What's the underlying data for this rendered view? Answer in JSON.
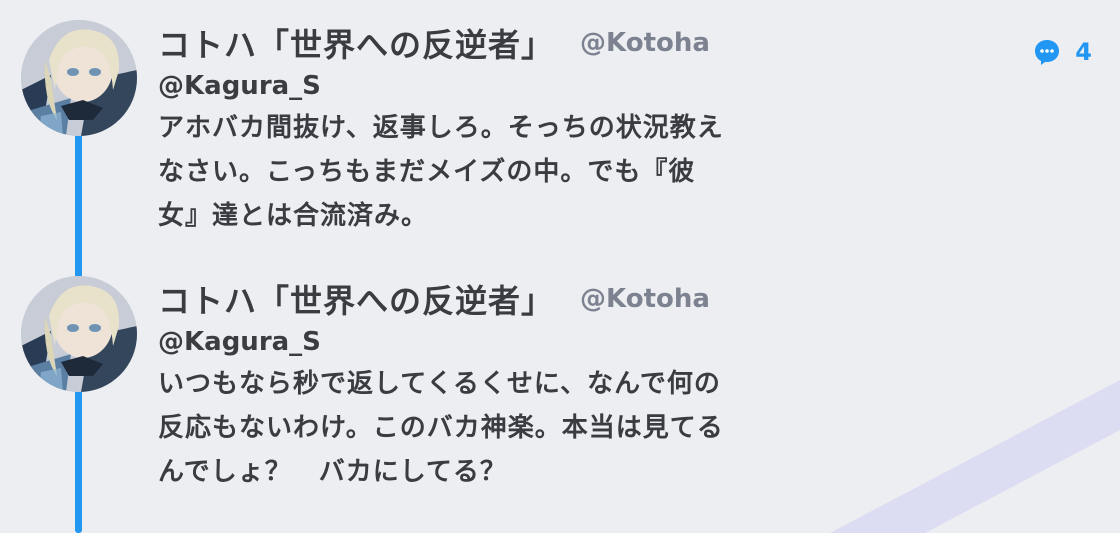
{
  "colors": {
    "accent": "#2196f3",
    "background": "#eceef2",
    "text": "#3b3b42",
    "handle": "#7c8290"
  },
  "posts": [
    {
      "avatar_icon": "character-avatar",
      "display_name": "コトハ「世界への反逆者」",
      "handle": "@Kotoha",
      "reply_to": "@Kagura_S",
      "message": "アホバカ間抜け、返事しろ。そっちの状況教え\nなさい。こっちもまだメイズの中。でも『彼\n女』達とは合流済み。",
      "reply_count": "4"
    },
    {
      "avatar_icon": "character-avatar",
      "display_name": "コトハ「世界への反逆者」",
      "handle": "@Kotoha",
      "reply_to": "@Kagura_S",
      "message": "いつもなら秒で返してくるくせに、なんで何の\n反応もないわけ。このバカ神楽。本当は見てる\nんでしょ？　バカにしてる？"
    }
  ]
}
